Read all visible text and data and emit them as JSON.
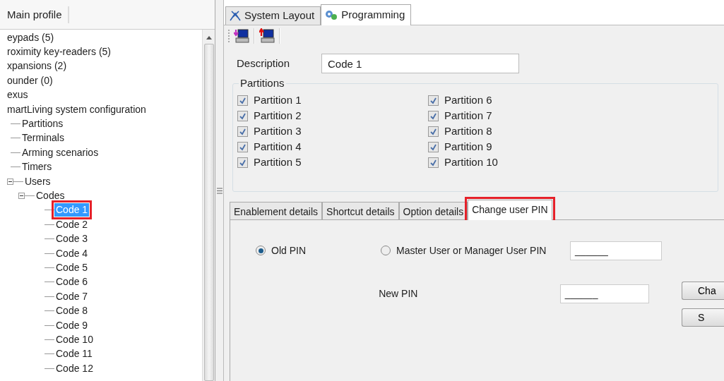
{
  "profile": {
    "title": "Main profile"
  },
  "tree": [
    {
      "label": "eypads (5)",
      "selected": false,
      "highlighted": false
    },
    {
      "label": "roximity key-readers (5)",
      "selected": false,
      "highlighted": false
    },
    {
      "label": "xpansions (2)",
      "selected": false,
      "highlighted": false
    },
    {
      "label": "ounder (0)",
      "selected": false,
      "highlighted": false
    },
    {
      "label": "exus",
      "selected": false,
      "highlighted": false
    },
    {
      "label": "martLiving system configuration",
      "selected": false,
      "highlighted": false,
      "children": [
        {
          "label": "Partitions",
          "selected": false,
          "highlighted": false
        },
        {
          "label": "Terminals",
          "selected": false,
          "highlighted": false
        },
        {
          "label": "Arming scenarios",
          "selected": false,
          "highlighted": false
        },
        {
          "label": "Timers",
          "selected": false,
          "highlighted": false
        },
        {
          "label": "Users",
          "selected": false,
          "highlighted": false,
          "expanded": true,
          "children": [
            {
              "label": "Codes",
              "selected": false,
              "highlighted": false,
              "expanded": true,
              "children": [
                {
                  "label": "Code 1",
                  "selected": true,
                  "highlighted": true
                },
                {
                  "label": "Code 2",
                  "selected": false,
                  "highlighted": false
                },
                {
                  "label": "Code 3",
                  "selected": false,
                  "highlighted": false
                },
                {
                  "label": "Code 4",
                  "selected": false,
                  "highlighted": false
                },
                {
                  "label": "Code 5",
                  "selected": false,
                  "highlighted": false
                },
                {
                  "label": "Code 6",
                  "selected": false,
                  "highlighted": false
                },
                {
                  "label": "Code 7",
                  "selected": false,
                  "highlighted": false
                },
                {
                  "label": "Code 8",
                  "selected": false,
                  "highlighted": false
                },
                {
                  "label": "Code 9",
                  "selected": false,
                  "highlighted": false
                },
                {
                  "label": "Code 10",
                  "selected": false,
                  "highlighted": false
                },
                {
                  "label": "Code 11",
                  "selected": false,
                  "highlighted": false
                },
                {
                  "label": "Code 12",
                  "selected": false,
                  "highlighted": false
                }
              ]
            }
          ]
        }
      ]
    }
  ],
  "main_tabs": [
    {
      "label": "System Layout",
      "kind": "layout",
      "selected": false
    },
    {
      "label": "Programming",
      "kind": "gears",
      "selected": true
    }
  ],
  "toolbar": [
    {
      "kind": "download"
    },
    {
      "kind": "upload"
    }
  ],
  "description": {
    "label": "Description",
    "value": "Code 1"
  },
  "partitions": {
    "title": "Partitions",
    "items": [
      {
        "label": "Partition 1",
        "checked": true
      },
      {
        "label": "Partition 2",
        "checked": true
      },
      {
        "label": "Partition 3",
        "checked": true
      },
      {
        "label": "Partition 4",
        "checked": true
      },
      {
        "label": "Partition 5",
        "checked": true
      },
      {
        "label": "Partition 6",
        "checked": true
      },
      {
        "label": "Partition 7",
        "checked": true
      },
      {
        "label": "Partition 8",
        "checked": true
      },
      {
        "label": "Partition 9",
        "checked": true
      },
      {
        "label": "Partition 10",
        "checked": true
      }
    ]
  },
  "detail_tabs": [
    {
      "label": "Enablement details",
      "selected": false,
      "highlighted": false
    },
    {
      "label": "Shortcut details",
      "selected": false,
      "highlighted": false
    },
    {
      "label": "Option details",
      "selected": false,
      "highlighted": false
    },
    {
      "label": "Change user PIN",
      "selected": true,
      "highlighted": true
    }
  ],
  "pin": {
    "options": [
      {
        "label": "Old PIN",
        "selected": true
      },
      {
        "label": "Master User or Manager User PIN",
        "selected": false
      }
    ],
    "master_value": "______",
    "new_pin_label": "New PIN",
    "new_pin_value": "______",
    "buttons": [
      "Cha",
      "S"
    ]
  }
}
